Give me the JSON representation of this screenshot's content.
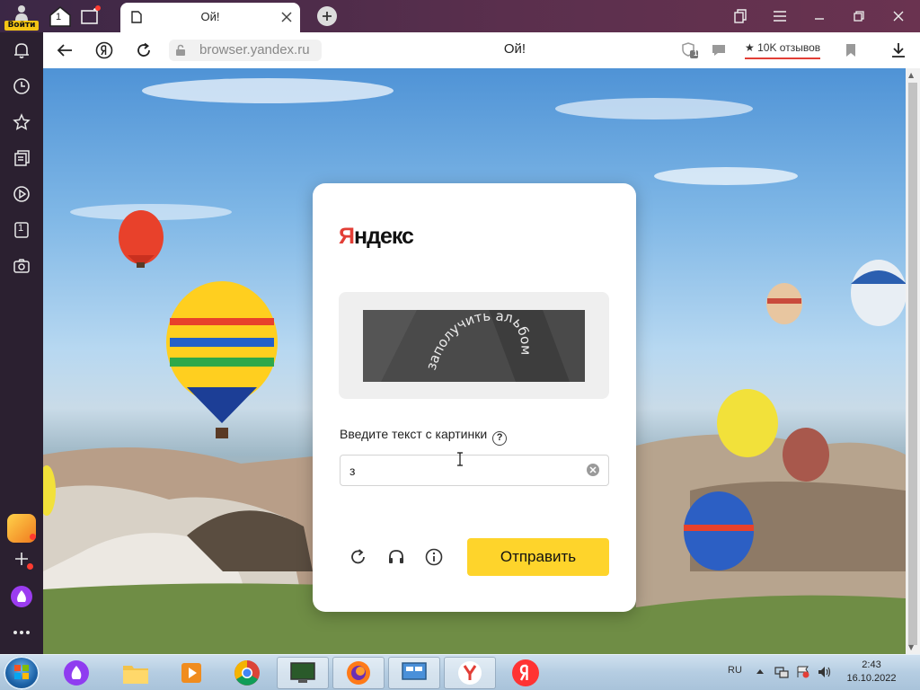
{
  "browser": {
    "profile": {
      "label": "Войти",
      "icon": "user-icon"
    },
    "tab_counter": "1",
    "active_tab": {
      "title": "Ой!",
      "icon": "document-icon"
    },
    "address": {
      "url": "browser.yandex.ru",
      "title": "Ой!",
      "reviews": "10K отзывов",
      "reviews_prefix": "★",
      "notifications_count": "1"
    },
    "sidebar": [
      {
        "name": "notifications",
        "icon": "bell-icon"
      },
      {
        "name": "history",
        "icon": "clock-icon"
      },
      {
        "name": "bookmarks",
        "icon": "star-icon"
      },
      {
        "name": "collections",
        "icon": "collections-icon"
      },
      {
        "name": "video",
        "icon": "play-icon"
      },
      {
        "name": "tabs",
        "icon": "tab-number-icon",
        "label": "1"
      },
      {
        "name": "screenshot",
        "icon": "camera-icon"
      }
    ]
  },
  "captcha": {
    "logo_first": "Я",
    "logo_rest": "ндекс",
    "image_text": "заполучить альбом",
    "prompt": "Введите текст с картинки",
    "help_symbol": "?",
    "input_value": "з",
    "submit_label": "Отправить"
  },
  "taskbar": {
    "language": "RU",
    "time": "2:43",
    "date": "16.10.2022"
  },
  "colors": {
    "accent_yellow": "#fed42b",
    "yandex_red": "#e23e36",
    "sidebar_bg": "#2b2030"
  }
}
